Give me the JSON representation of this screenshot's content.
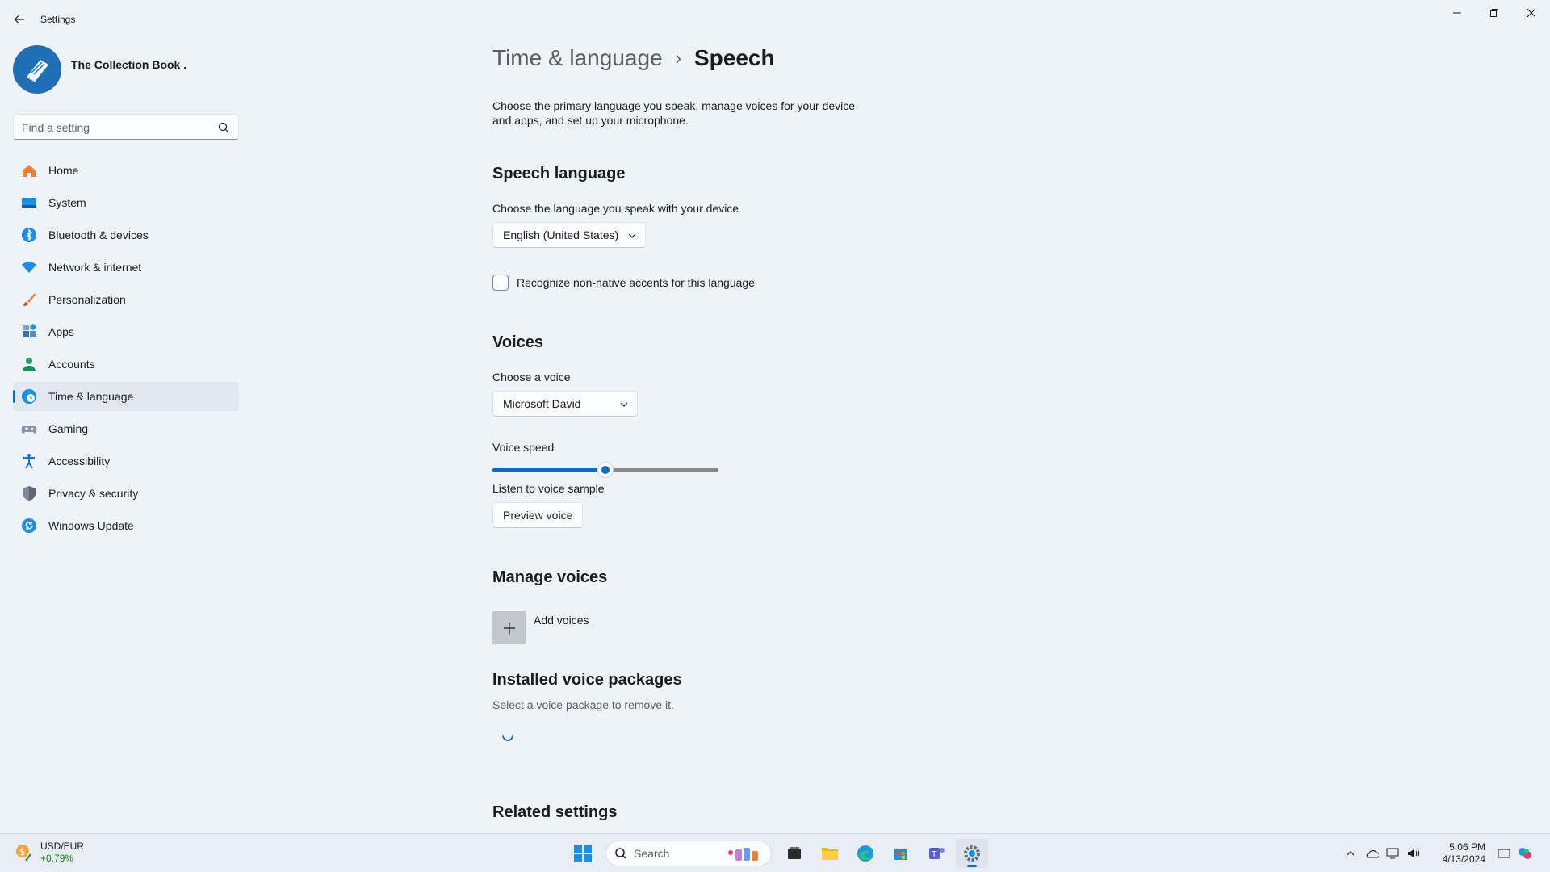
{
  "window": {
    "app_title": "Settings",
    "profile_name": "The Collection Book .",
    "search_placeholder": "Find a setting"
  },
  "sidebar": {
    "items": [
      {
        "label": "Home",
        "icon": "home-icon"
      },
      {
        "label": "System",
        "icon": "system-icon"
      },
      {
        "label": "Bluetooth & devices",
        "icon": "bluetooth-icon"
      },
      {
        "label": "Network & internet",
        "icon": "wifi-icon"
      },
      {
        "label": "Personalization",
        "icon": "brush-icon"
      },
      {
        "label": "Apps",
        "icon": "apps-icon"
      },
      {
        "label": "Accounts",
        "icon": "accounts-icon"
      },
      {
        "label": "Time & language",
        "icon": "time-language-icon",
        "active": true
      },
      {
        "label": "Gaming",
        "icon": "gamepad-icon"
      },
      {
        "label": "Accessibility",
        "icon": "accessibility-icon"
      },
      {
        "label": "Privacy & security",
        "icon": "shield-icon"
      },
      {
        "label": "Windows Update",
        "icon": "update-icon"
      }
    ]
  },
  "breadcrumb": {
    "parent": "Time & language",
    "separator": "›",
    "current": "Speech"
  },
  "intro": "Choose the primary language you speak, manage voices for your device and apps, and set up your microphone.",
  "speech_language": {
    "title": "Speech language",
    "label": "Choose the language you speak with your device",
    "selected": "English (United States)",
    "checkbox_label": "Recognize non-native accents for this language",
    "checkbox_checked": false
  },
  "voices": {
    "title": "Voices",
    "choose_label": "Choose a voice",
    "selected_voice": "Microsoft David",
    "speed_label": "Voice speed",
    "speed_fraction": 0.5,
    "sample_label": "Listen to voice sample",
    "preview_button": "Preview voice"
  },
  "manage_voices": {
    "title": "Manage voices",
    "add_label": "Add voices"
  },
  "installed": {
    "title": "Installed voice packages",
    "subtitle": "Select a voice package to remove it."
  },
  "related": {
    "title": "Related settings"
  },
  "taskbar": {
    "widget_title": "USD/EUR",
    "widget_value": "+0.79%",
    "search_label": "Search",
    "time": "5:06 PM",
    "date": "4/13/2024"
  },
  "colors": {
    "accent": "#0f6cbd",
    "background": "#eef3fa",
    "positive": "#107c10"
  }
}
